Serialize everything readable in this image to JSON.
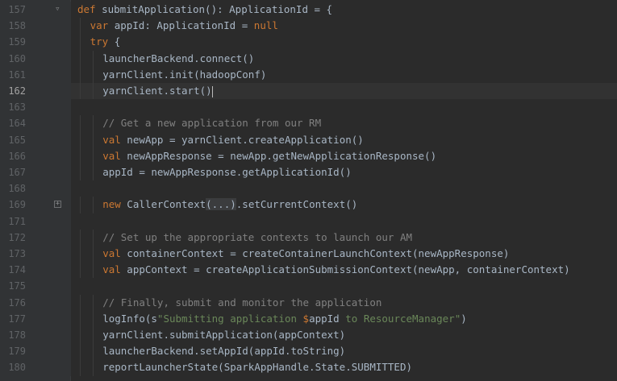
{
  "editor": {
    "current_line": 162,
    "lines": [
      {
        "n": "157",
        "fold": "arrow",
        "indent": 0,
        "tokens": [
          {
            "t": "def",
            "c": "kw"
          },
          {
            "t": " submitApplication(): ApplicationId = {",
            "c": "text"
          }
        ]
      },
      {
        "n": "158",
        "indent": 1,
        "tokens": [
          {
            "t": "var",
            "c": "kw"
          },
          {
            "t": " appId: ApplicationId = ",
            "c": "text"
          },
          {
            "t": "null",
            "c": "kw"
          }
        ]
      },
      {
        "n": "159",
        "indent": 1,
        "tokens": [
          {
            "t": "try",
            "c": "kw"
          },
          {
            "t": " {",
            "c": "text"
          }
        ]
      },
      {
        "n": "160",
        "indent": 2,
        "tokens": [
          {
            "t": "launcherBackend.connect()",
            "c": "text"
          }
        ]
      },
      {
        "n": "161",
        "indent": 2,
        "tokens": [
          {
            "t": "yarnClient.init(hadoopConf)",
            "c": "text"
          }
        ]
      },
      {
        "n": "162",
        "indent": 2,
        "caret": true,
        "tokens": [
          {
            "t": "yarnClient.start()",
            "c": "text"
          }
        ]
      },
      {
        "n": "163",
        "indent": 0,
        "tokens": []
      },
      {
        "n": "164",
        "indent": 2,
        "tokens": [
          {
            "t": "// Get a new application from our RM",
            "c": "cm"
          }
        ]
      },
      {
        "n": "165",
        "indent": 2,
        "tokens": [
          {
            "t": "val",
            "c": "kw"
          },
          {
            "t": " newApp = yarnClient.createApplication()",
            "c": "text"
          }
        ]
      },
      {
        "n": "166",
        "indent": 2,
        "tokens": [
          {
            "t": "val",
            "c": "kw"
          },
          {
            "t": " newAppResponse = newApp.getNewApplicationResponse()",
            "c": "text"
          }
        ]
      },
      {
        "n": "167",
        "indent": 2,
        "tokens": [
          {
            "t": "appId = newAppResponse.getApplicationId()",
            "c": "text"
          }
        ]
      },
      {
        "n": "168",
        "indent": 0,
        "tokens": []
      },
      {
        "n": "169",
        "fold": "box",
        "indent": 2,
        "tokens": [
          {
            "t": "new",
            "c": "kw"
          },
          {
            "t": " CallerContext",
            "c": "text"
          },
          {
            "t": "(...)",
            "c": "fold-region"
          },
          {
            "t": ".setCurrentContext()",
            "c": "text"
          }
        ]
      },
      {
        "n": "171",
        "indent": 0,
        "tokens": []
      },
      {
        "n": "172",
        "indent": 2,
        "tokens": [
          {
            "t": "// Set up the appropriate contexts to launch our AM",
            "c": "cm"
          }
        ]
      },
      {
        "n": "173",
        "indent": 2,
        "tokens": [
          {
            "t": "val",
            "c": "kw"
          },
          {
            "t": " containerContext = createContainerLaunchContext(newAppResponse)",
            "c": "text"
          }
        ]
      },
      {
        "n": "174",
        "indent": 2,
        "tokens": [
          {
            "t": "val",
            "c": "kw"
          },
          {
            "t": " appContext = createApplicationSubmissionContext(newApp, containerContext)",
            "c": "text"
          }
        ]
      },
      {
        "n": "175",
        "indent": 0,
        "tokens": []
      },
      {
        "n": "176",
        "indent": 2,
        "tokens": [
          {
            "t": "// Finally, submit and monitor the application",
            "c": "cm"
          }
        ]
      },
      {
        "n": "177",
        "indent": 2,
        "tokens": [
          {
            "t": "logInfo(s",
            "c": "text"
          },
          {
            "t": "\"Submitting application ",
            "c": "str"
          },
          {
            "t": "$",
            "c": "id-tpl"
          },
          {
            "t": "appId",
            "c": "text"
          },
          {
            "t": " to ResourceManager\"",
            "c": "str"
          },
          {
            "t": ")",
            "c": "text"
          }
        ]
      },
      {
        "n": "178",
        "indent": 2,
        "tokens": [
          {
            "t": "yarnClient.submitApplication(appContext)",
            "c": "text"
          }
        ]
      },
      {
        "n": "179",
        "indent": 2,
        "tokens": [
          {
            "t": "launcherBackend.setAppId(appId.toString)",
            "c": "text"
          }
        ]
      },
      {
        "n": "180",
        "indent": 2,
        "tokens": [
          {
            "t": "reportLauncherState(SparkAppHandle.State.SUBMITTED)",
            "c": "text"
          }
        ]
      }
    ]
  },
  "colors": {
    "background": "#2b2b2b",
    "gutter": "#313335",
    "keyword": "#cc7832",
    "comment": "#808080",
    "string": "#6a8759",
    "text": "#a9b7c6",
    "line_number": "#606366"
  }
}
